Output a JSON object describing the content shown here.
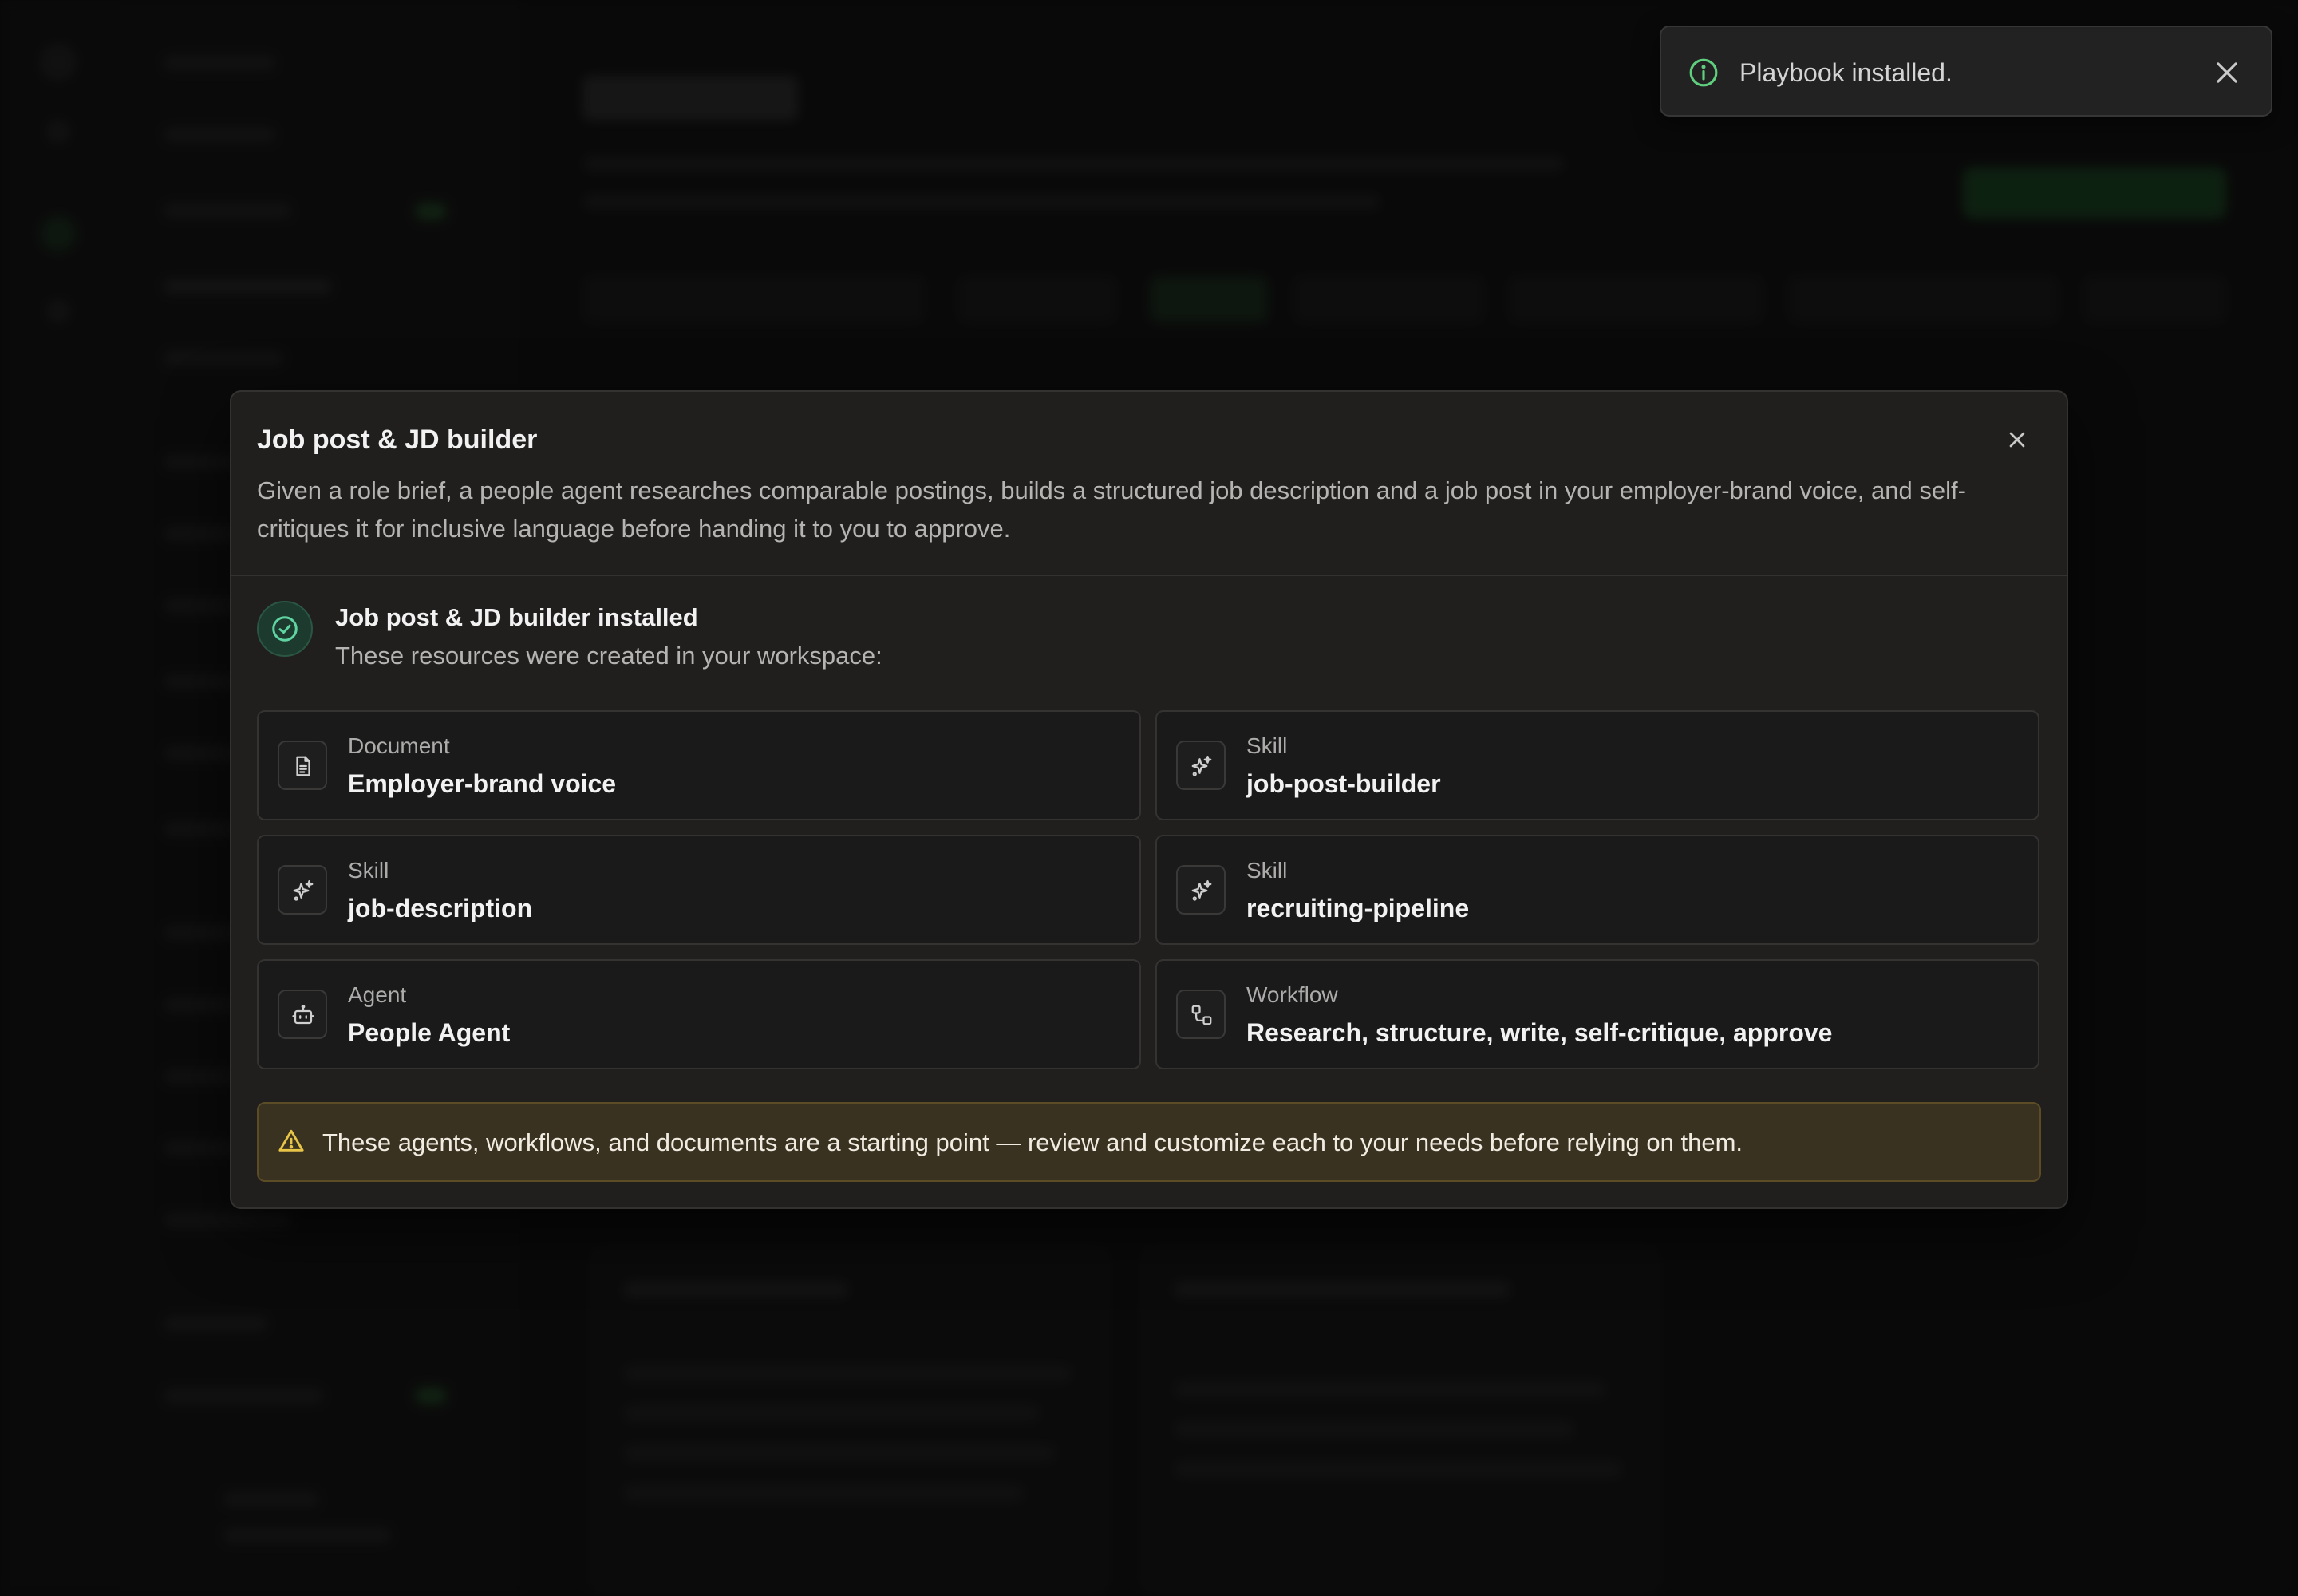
{
  "toast": {
    "message": "Playbook installed.",
    "icon": "info-icon",
    "accent": "#5fcf7e"
  },
  "modal": {
    "title": "Job post & JD builder",
    "description": "Given a role brief, a people agent researches comparable postings, builds a structured job description and a job post in your employer-brand voice, and self-critiques it for inclusive language before handing it to you to approve.",
    "installed": {
      "title": "Job post & JD builder installed",
      "subtitle": "These resources were created in your workspace:",
      "accent": "#5fd3a0"
    },
    "resources": [
      {
        "type": "Document",
        "name": "Employer-brand voice",
        "icon": "document-icon"
      },
      {
        "type": "Skill",
        "name": "job-post-builder",
        "icon": "sparkle-icon"
      },
      {
        "type": "Skill",
        "name": "job-description",
        "icon": "sparkle-icon"
      },
      {
        "type": "Skill",
        "name": "recruiting-pipeline",
        "icon": "sparkle-icon"
      },
      {
        "type": "Agent",
        "name": "People Agent",
        "icon": "robot-icon"
      },
      {
        "type": "Workflow",
        "name": "Research, structure, write, self-critique, approve",
        "icon": "workflow-icon"
      }
    ],
    "warning": {
      "text": "These agents, workflows, and documents are a starting point — review and customize each to your needs before relying on them.",
      "icon": "warning-icon",
      "accent": "#e8c547"
    }
  }
}
